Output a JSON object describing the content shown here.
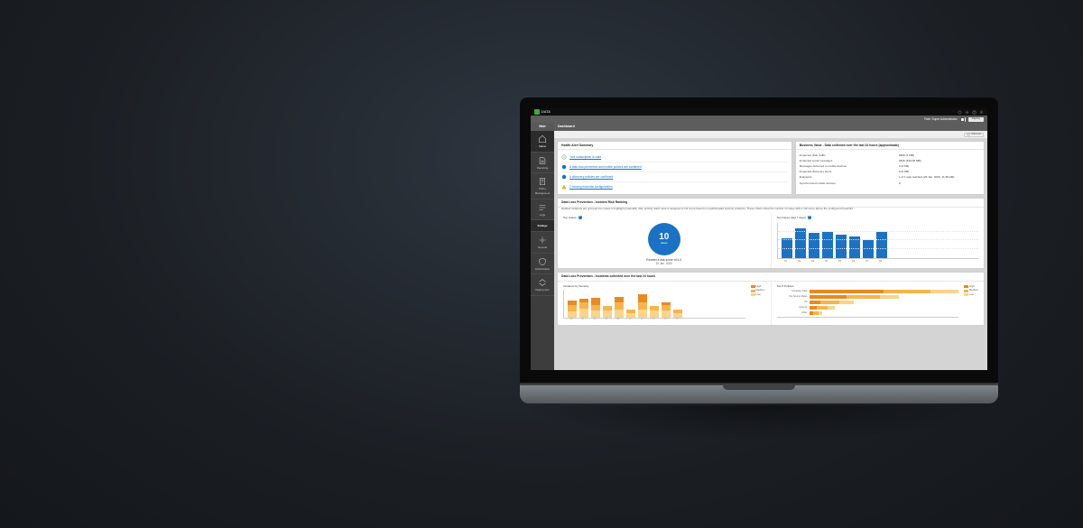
{
  "topbar": {
    "brand": "DATA"
  },
  "rolebar": {
    "role_label": "Role: Super Administrator",
    "deploy_btn": "Deploy"
  },
  "sidenav": {
    "rail": "Main",
    "items": [
      {
        "label": "Status"
      },
      {
        "label": "Reporting"
      },
      {
        "label": "Policy Management"
      },
      {
        "label": "Logs"
      },
      {
        "label": "Settings"
      },
      {
        "label": "General"
      },
      {
        "label": "Authorization"
      },
      {
        "label": "Deployment"
      }
    ]
  },
  "page": {
    "title": "Dashboard",
    "refresh": "Refresh"
  },
  "health": {
    "title": "Health Alert Summary",
    "items": [
      {
        "kind": "ok",
        "text": "Your subscription is valid"
      },
      {
        "kind": "info",
        "text": "A data loss prevention and mobile policies are confirmed"
      },
      {
        "kind": "info",
        "text": "A discovery policies are confirmed"
      },
      {
        "kind": "warn",
        "text": "1 missing essential configurations"
      }
    ]
  },
  "bizval": {
    "title": "Business Value - Data collected over the last 24 hours (approximate)",
    "rows": [
      {
        "k": "Inspected Web traffic",
        "v": "2849 (4 MB)"
      },
      {
        "k": "Inspected email messages",
        "v": "2816 (433.05 MB)"
      },
      {
        "k": "Messages delivered to mobile devices",
        "v": "0 (0 KB)"
      },
      {
        "k": "Inspected discovery items",
        "v": "0 (0 KB)"
      },
      {
        "k": "Endpoints",
        "v": "1 of 1 was reached (29 Jan. 2020, 11:39 AM)"
      },
      {
        "k": "Synchronized mobile devices",
        "v": "0"
      }
    ]
  },
  "dlp_risk": {
    "title": "Data Loss Prevention - Incident Risk Ranking",
    "desc": "Related incidents are grouped into cases to highlight potentially risky activity. Each case is assigned a risk score based on sophisticated security analytics. These charts show the number of cases with a risk score above the configured threshold.",
    "left_sub": "Top Cases",
    "circle_num": "10",
    "circle_unit": "cases",
    "caption": "Exceed a risk score of 4.0",
    "date": "15 Jan. 2020",
    "right_sub": "Top Cases (last 7 days)"
  },
  "dlp_24": {
    "title": "Data Loss Prevention - Incidents collected over the last 24 hours",
    "left_sub": "Incidents by Severity",
    "right_sub": "Top 5 Policies",
    "legend": {
      "high": "High",
      "medium": "Medium",
      "low": "Low"
    },
    "policies": [
      "Company Data",
      "Top Source Rules",
      "PII",
      "Finance",
      "Other"
    ]
  },
  "chart_data": [
    {
      "type": "bar",
      "title": "Top Cases (last 7 days)",
      "categories": [
        "D1",
        "D2",
        "D3",
        "D4",
        "D5",
        "D6",
        "D7",
        "D8"
      ],
      "values": [
        22,
        34,
        28,
        30,
        26,
        24,
        20,
        30
      ],
      "ylim": [
        0,
        40
      ]
    },
    {
      "type": "bar",
      "title": "Incidents by Severity (stacked)",
      "categories": [
        "00",
        "02",
        "04",
        "06",
        "08",
        "10",
        "12",
        "14",
        "16",
        "18"
      ],
      "series": [
        {
          "name": "High",
          "values": [
            4,
            3,
            6,
            0,
            5,
            0,
            7,
            0,
            2,
            0
          ]
        },
        {
          "name": "Medium",
          "values": [
            6,
            5,
            5,
            4,
            6,
            3,
            6,
            4,
            5,
            3
          ]
        },
        {
          "name": "Low",
          "values": [
            5,
            8,
            6,
            6,
            7,
            4,
            7,
            6,
            6,
            4
          ]
        }
      ],
      "ylim": [
        0,
        25
      ]
    },
    {
      "type": "bar",
      "title": "Top 5 Policies (horizontal stacked)",
      "categories": [
        "Company Data",
        "Top Source Rules",
        "PII",
        "Finance",
        "Other"
      ],
      "series": [
        {
          "name": "High",
          "values": [
            40,
            20,
            6,
            4,
            2
          ]
        },
        {
          "name": "Medium",
          "values": [
            25,
            18,
            10,
            6,
            3
          ]
        },
        {
          "name": "Low",
          "values": [
            15,
            10,
            8,
            4,
            2
          ]
        }
      ],
      "xlim": [
        0,
        80
      ]
    }
  ]
}
